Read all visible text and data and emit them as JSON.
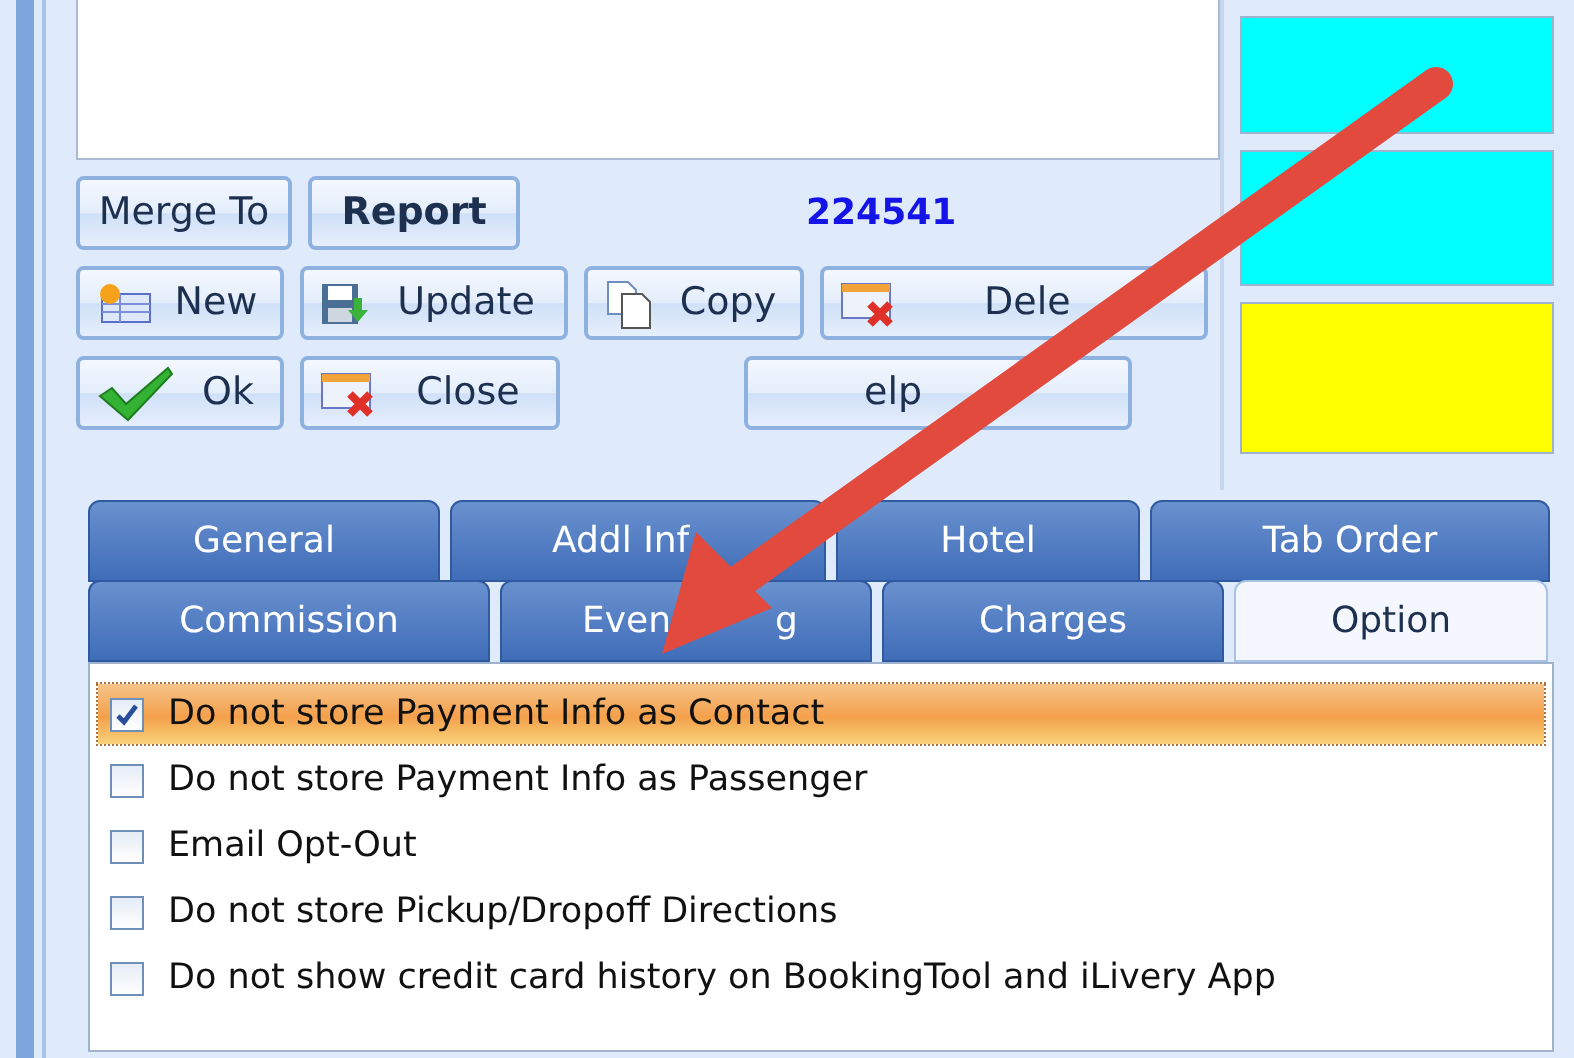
{
  "button_rows": [
    [
      {
        "label": "Merge To",
        "kind": "plain"
      },
      {
        "label": "Report",
        "kind": "bold"
      }
    ],
    [
      {
        "label": "New",
        "kind": "new"
      },
      {
        "label": "Update",
        "kind": "update"
      },
      {
        "label": "Copy",
        "kind": "copy"
      },
      {
        "label": "Dele",
        "kind": "delete"
      }
    ],
    [
      {
        "label": "Ok",
        "kind": "ok"
      },
      {
        "label": "Close",
        "kind": "close"
      },
      {
        "label": "elp",
        "kind": "wide"
      }
    ]
  ],
  "record_number": "224541",
  "color_panels": [
    {
      "color": "#00ffff"
    },
    {
      "color": "#00ffff"
    },
    {
      "color": "#ffff00"
    }
  ],
  "tab_rows": [
    [
      {
        "label": "General",
        "selected": false
      },
      {
        "label": "Addl Inf",
        "selected": false
      },
      {
        "label": "Hotel",
        "selected": false
      },
      {
        "label": "Tab Order",
        "selected": false
      }
    ],
    [
      {
        "label": "Commission",
        "selected": false
      },
      {
        "label": "Even",
        "trailing_text": "g",
        "selected": false
      },
      {
        "label": "Charges",
        "selected": false
      },
      {
        "label": "Option",
        "selected": true
      }
    ]
  ],
  "options": [
    {
      "label": "Do not store Payment Info as Contact",
      "checked": true,
      "selected": true
    },
    {
      "label": "Do not store Payment Info as Passenger",
      "checked": false,
      "selected": false
    },
    {
      "label": "Email Opt-Out",
      "checked": false,
      "selected": false
    },
    {
      "label": "Do not store Pickup/Dropoff Directions",
      "checked": false,
      "selected": false
    },
    {
      "label": "Do not show credit card history on BookingTool and iLivery App",
      "checked": false,
      "selected": false
    }
  ]
}
